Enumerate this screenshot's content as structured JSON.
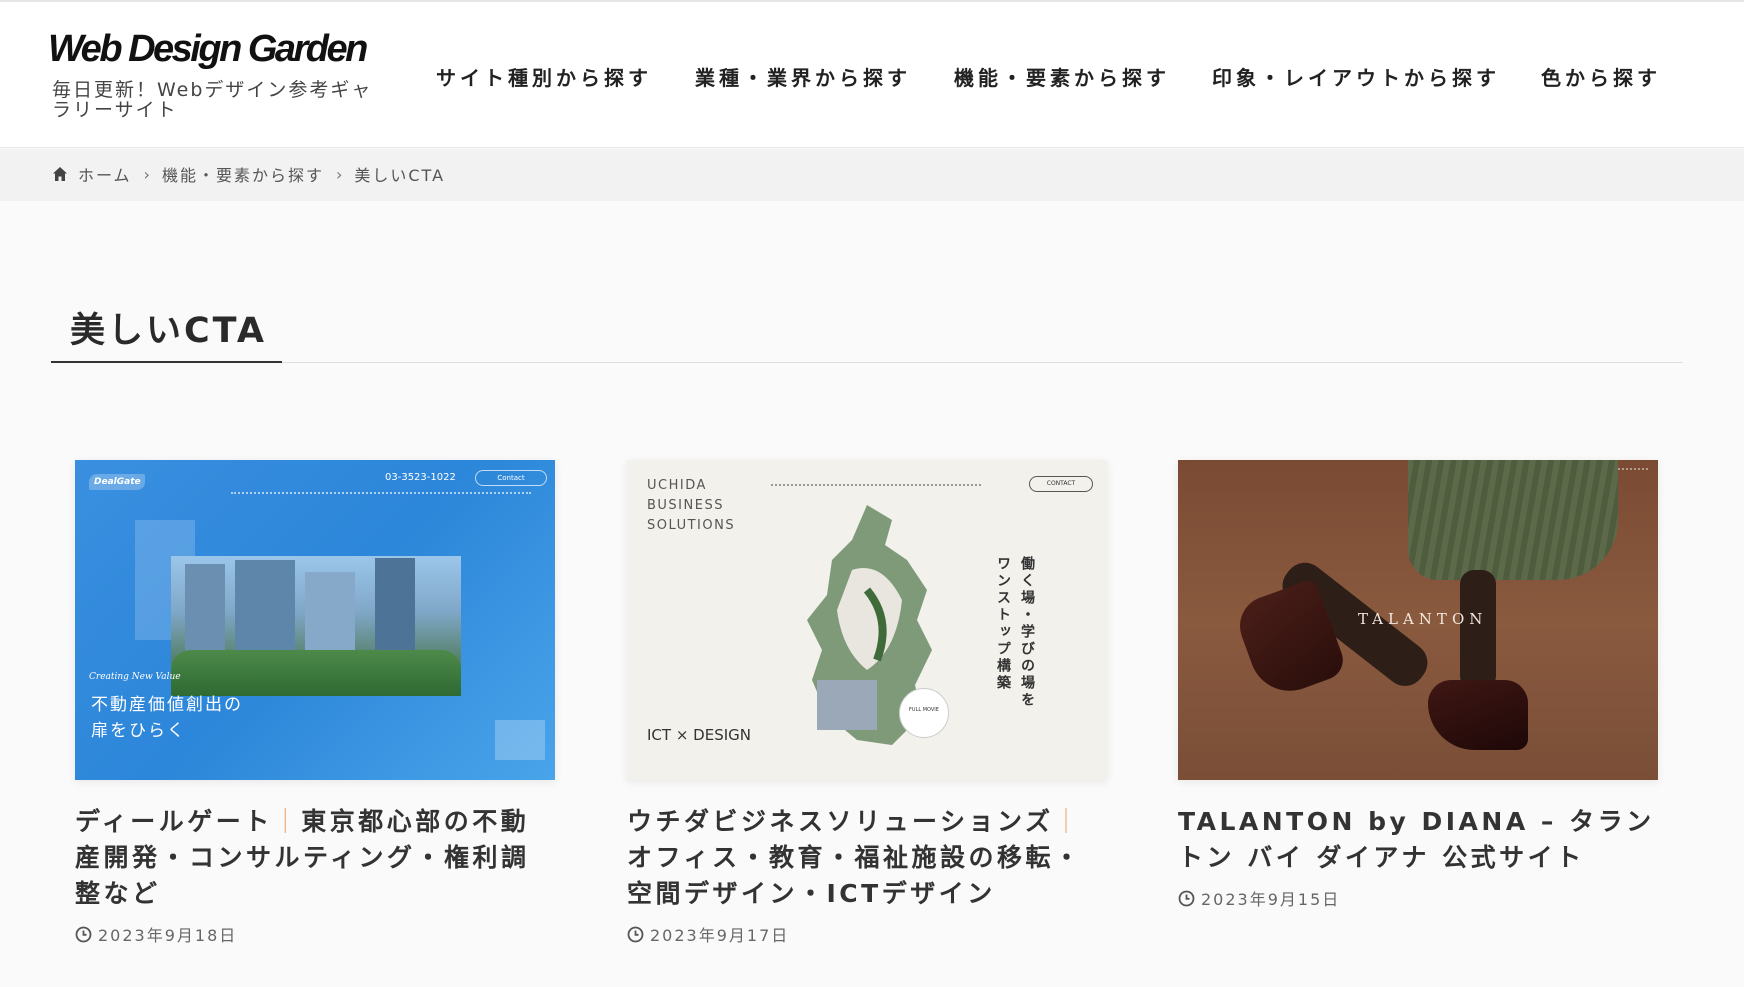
{
  "site": {
    "logo": "Web Design Garden",
    "tagline": "毎日更新！Webデザイン参考ギャラリーサイト"
  },
  "nav": {
    "items": [
      {
        "label": "サイト種別から探す"
      },
      {
        "label": "業種・業界から探す"
      },
      {
        "label": "機能・要素から探す"
      },
      {
        "label": "印象・レイアウトから探す"
      },
      {
        "label": "色から探す"
      }
    ]
  },
  "breadcrumb": {
    "home_icon": "home-icon",
    "home": "ホーム",
    "parent": "機能・要素から探す",
    "current": "美しいCTA",
    "separator": "›"
  },
  "page": {
    "title": "美しいCTA"
  },
  "colors": {
    "header_bg": "#ffffff",
    "breadcrumb_bg": "#f2f2f2",
    "page_bg": "#fafafa",
    "text": "#333333",
    "accent_rule": "#333333"
  },
  "cards": [
    {
      "title_part1": "ディールゲート",
      "divider": "｜",
      "title_part2": "東京都心部の不動産開発・コンサルティング・権利調整など",
      "date": "2023年9月18日",
      "date_icon": "clock-icon",
      "thumb": {
        "logo": "DealGate",
        "phone": "03-3523-1022",
        "contact": "Contact",
        "sub": "Creating New Value",
        "catch_line1": "不動産価値創出の",
        "catch_line2": "扉をひらく"
      }
    },
    {
      "title_part1": "ウチダビジネスソリューションズ",
      "divider": "｜",
      "title_part2": "オフィス・教育・福祉施設の移転・空間デザイン・ICTデザイン",
      "date": "2023年9月17日",
      "date_icon": "clock-icon",
      "thumb": {
        "brand_line1": "UCHIDA",
        "brand_line2": "BUSINESS",
        "brand_line3": "SOLUTIONS",
        "contact": "CONTACT",
        "vertical_copy1": "働く場・学びの場を",
        "vertical_copy2": "ワンストップ構築",
        "ict_label": "ICT × DESIGN",
        "movie": "FULL MOVIE"
      }
    },
    {
      "title_part1": "TALANTON by DIANA – タラントン バイ ダイアナ 公式サイト",
      "divider": "",
      "title_part2": "",
      "date": "2023年9月15日",
      "date_icon": "clock-icon",
      "thumb": {
        "brand": "TALANTON"
      }
    }
  ]
}
